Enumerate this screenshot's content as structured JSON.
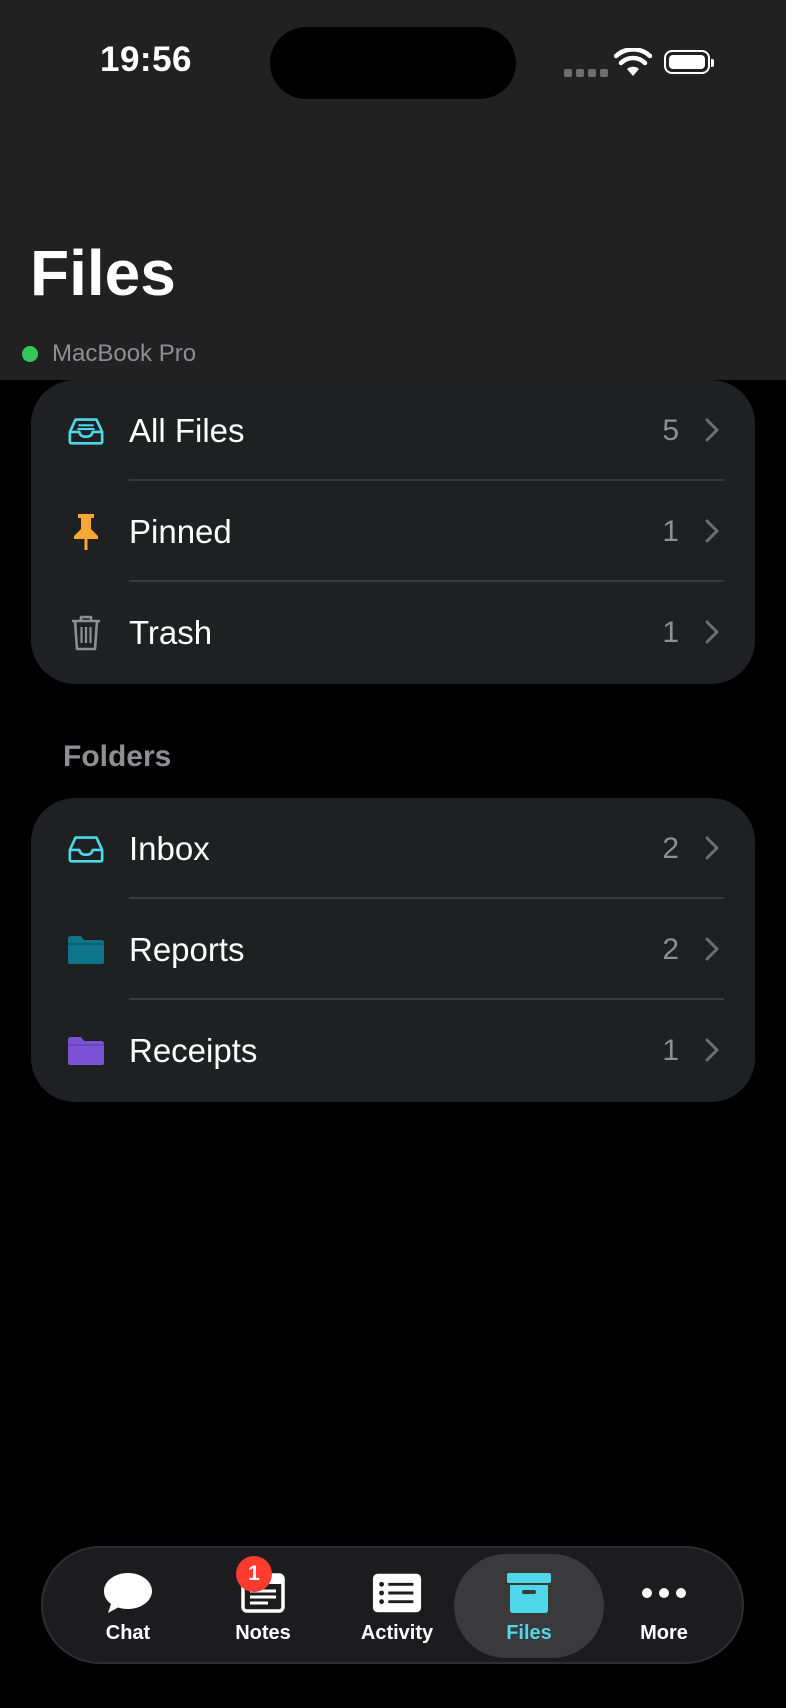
{
  "status_bar": {
    "time": "19:56"
  },
  "header": {
    "title": "Files",
    "device_name": "MacBook Pro",
    "device_status_color": "#34c759"
  },
  "library": [
    {
      "label": "All Files",
      "count": "5",
      "icon": "tray-icon",
      "icon_color": "#4fd6e8"
    },
    {
      "label": "Pinned",
      "count": "1",
      "icon": "pin-icon",
      "icon_color": "#f7a733"
    },
    {
      "label": "Trash",
      "count": "1",
      "icon": "trash-icon",
      "icon_color": "#8e8e93"
    }
  ],
  "folders_header": "Folders",
  "folders": [
    {
      "label": "Inbox",
      "count": "2",
      "icon": "tray-icon",
      "icon_color": "#4fd6e8"
    },
    {
      "label": "Reports",
      "count": "2",
      "icon": "folder-icon",
      "icon_color": "#0e7489"
    },
    {
      "label": "Receipts",
      "count": "1",
      "icon": "folder-icon",
      "icon_color": "#7b52d6"
    }
  ],
  "tabbar": {
    "tabs": [
      {
        "label": "Chat",
        "icon": "chat-bubble-icon"
      },
      {
        "label": "Notes",
        "icon": "notes-icon",
        "badge": "1"
      },
      {
        "label": "Activity",
        "icon": "list-icon"
      },
      {
        "label": "Files",
        "icon": "archive-box-icon",
        "active": true
      },
      {
        "label": "More",
        "icon": "ellipsis-icon"
      }
    ]
  },
  "colors": {
    "accent": "#4fd6e8",
    "background": "#000000",
    "card": "#1f2021",
    "header": "#212121"
  }
}
